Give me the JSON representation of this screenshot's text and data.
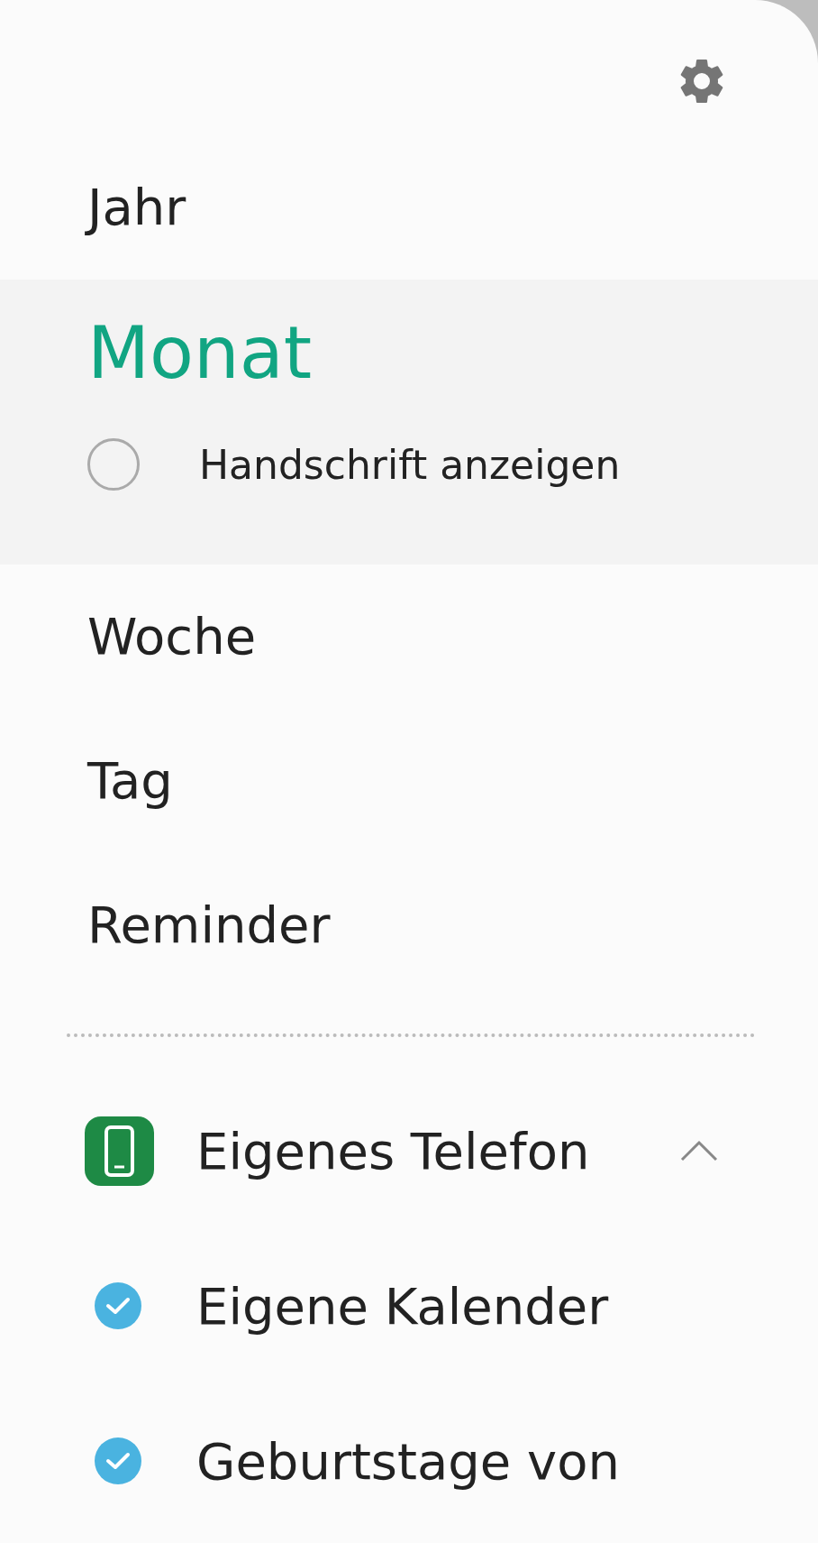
{
  "views": [
    {
      "label": "Jahr",
      "selected": false
    },
    {
      "label": "Monat",
      "selected": true,
      "option": {
        "label": "Handschrift anzeigen",
        "checked": false
      }
    },
    {
      "label": "Woche",
      "selected": false
    },
    {
      "label": "Tag",
      "selected": false
    },
    {
      "label": "Reminder",
      "selected": false
    }
  ],
  "accounts": [
    {
      "label": "Eigenes Telefon",
      "expanded": true,
      "calendars": [
        {
          "label": "Eigene Kalender",
          "checked": true,
          "color": "#4ab3e0"
        },
        {
          "label": "Geburtstage von",
          "checked": true,
          "color": "#4ab3e0"
        }
      ]
    }
  ]
}
